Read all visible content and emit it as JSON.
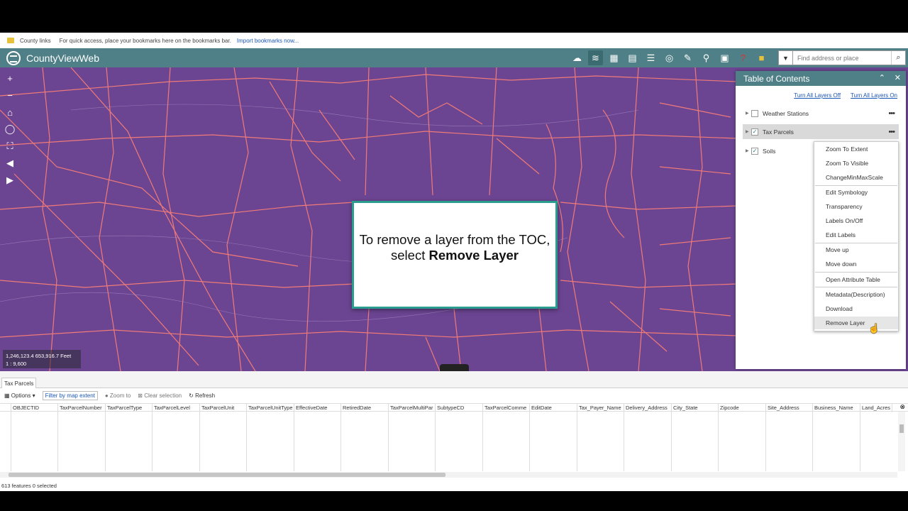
{
  "bookmarks": {
    "folder": "County links",
    "hint": "For quick access, place your bookmarks here on the bookmarks bar.",
    "import_link": "Import bookmarks now..."
  },
  "app": {
    "title": "CountyViewWeb"
  },
  "toolbar_icons": [
    "globe-icon",
    "layers-icon",
    "legend-icon",
    "table-icon",
    "list-icon",
    "compass-icon",
    "measure-icon",
    "tools-icon",
    "save-icon",
    "help-icon",
    "bookmark-icon"
  ],
  "search": {
    "placeholder": "Find address or place"
  },
  "map": {
    "coords": "1,246,123.4 653,916.7 Feet",
    "scale": "1 : 9,600",
    "accent": "#6b4592",
    "line_color": "#f07a78"
  },
  "callout": {
    "text_prefix": "To remove a layer from the TOC, select ",
    "text_bold": "Remove Layer"
  },
  "toc": {
    "title": "Table of Contents",
    "turn_off": "Turn All Layers Off",
    "turn_on": "Turn All Layers On",
    "layers": [
      {
        "label": "Weather Stations",
        "checked": false
      },
      {
        "label": "Tax Parcels",
        "checked": true
      },
      {
        "label": "Soils",
        "checked": true
      }
    ],
    "menu": [
      "Zoom To Extent",
      "Zoom To Visible",
      "ChangeMinMaxScale",
      "Edit Symbology",
      "Transparency",
      "Labels On/Off",
      "Edit Labels",
      "Move up",
      "Move down",
      "Open Attribute Table",
      "Metadata(Description)",
      "Download",
      "Remove Layer"
    ]
  },
  "attribute_table": {
    "tab": "Tax Parcels",
    "options": "Options",
    "filter": "Filter by map extent",
    "zoom_to": "Zoom to",
    "clear_selection": "Clear selection",
    "refresh": "Refresh",
    "columns": [
      "OBJECTID",
      "TaxParcelNumber",
      "TaxParcelType",
      "TaxParcelLevel",
      "TaxParcelUnit",
      "TaxParcelUnitType",
      "EffectiveDate",
      "RetiredDate",
      "TaxParcelMultiPar",
      "SubtypeCD",
      "TaxParcelComme",
      "EditDate",
      "Tax_Payer_Name",
      "Delivery_Address",
      "City_State",
      "Zipcode",
      "Site_Address",
      "Business_Name",
      "Land_Acres"
    ],
    "status": "613 features 0 selected"
  }
}
